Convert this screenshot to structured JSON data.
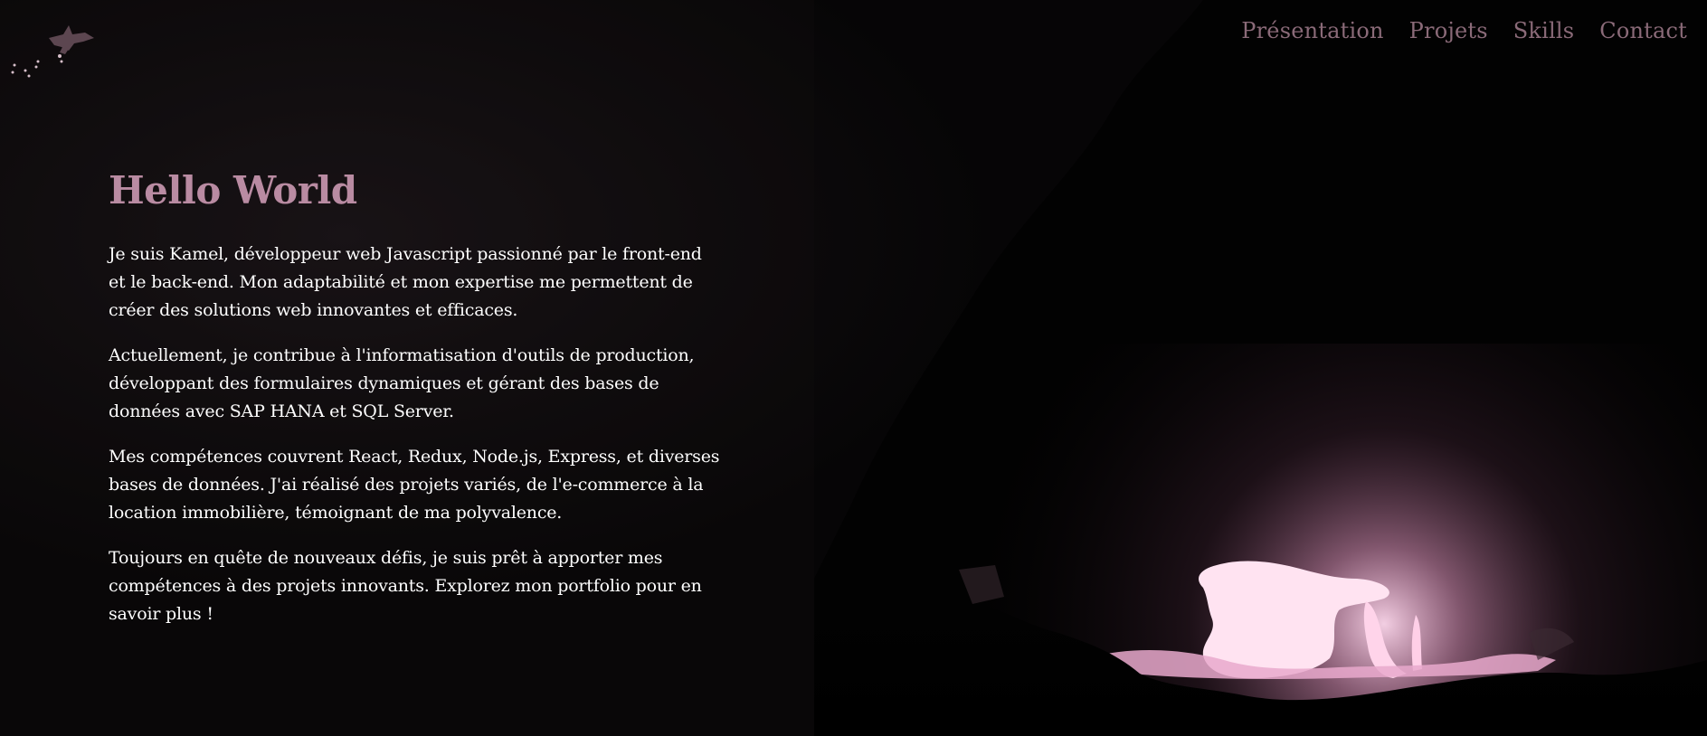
{
  "nav": {
    "items": [
      {
        "label": "Présentation"
      },
      {
        "label": "Projets"
      },
      {
        "label": "Skills"
      },
      {
        "label": "Contact"
      }
    ]
  },
  "hero": {
    "title": "Hello World",
    "paragraphs": [
      "Je suis Kamel, développeur web Javascript passionné par le front-end et le back-end. Mon adaptabilité et mon expertise me permettent de créer des solutions web innovantes et efficaces.",
      "Actuellement, je contribue à l'informatisation d'outils de production, développant des formulaires dynamiques et gérant des bases de données avec SAP HANA et SQL Server.",
      "Mes compétences couvrent React, Redux, Node.js, Express, et diverses bases de données. J'ai réalisé des projets variés, de l'e-commerce à la location immobilière, témoignant de ma polyvalence.",
      "Toujours en quête de nouveaux défis, je suis prêt à apporter mes compétences à des projets innovants. Explorez mon portfolio pour en savoir plus !"
    ]
  },
  "colors": {
    "accent": "#b98ba2",
    "nav_text": "#8a6a78",
    "body_text": "#ffffff",
    "background": "#000000",
    "fire": "#ffc9e6"
  },
  "icons": {
    "logo": "witch-on-broom-icon"
  }
}
